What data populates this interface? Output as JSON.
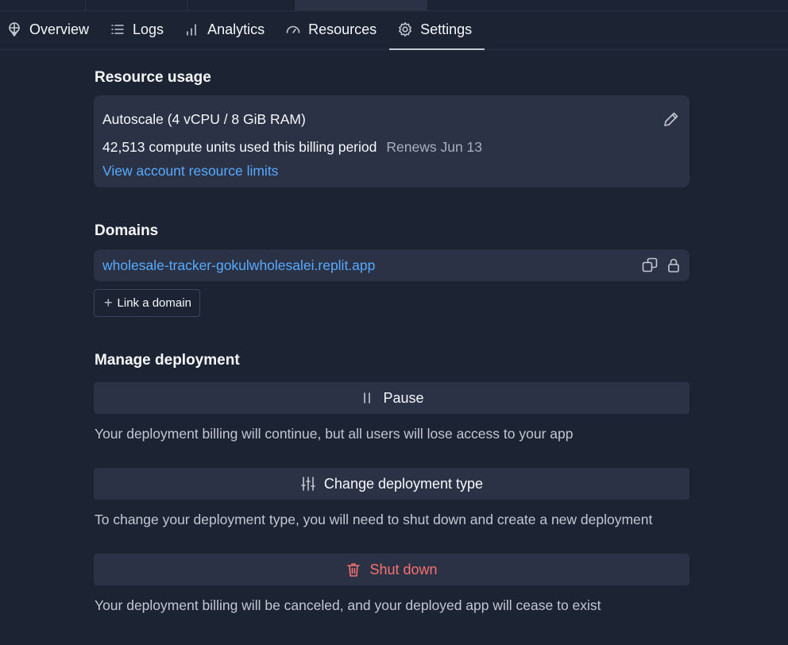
{
  "nav": {
    "tabs": [
      {
        "label": "Overview",
        "icon": "deploy-icon"
      },
      {
        "label": "Logs",
        "icon": "list-icon"
      },
      {
        "label": "Analytics",
        "icon": "bar-chart-icon"
      },
      {
        "label": "Resources",
        "icon": "gauge-icon"
      },
      {
        "label": "Settings",
        "icon": "gear-icon",
        "active": true
      }
    ]
  },
  "resource_usage": {
    "title": "Resource usage",
    "plan": "Autoscale (4 vCPU / 8 GiB RAM)",
    "usage": "42,513 compute units used this billing period",
    "renews": "Renews Jun 13",
    "limits_link": "View account resource limits"
  },
  "domains": {
    "title": "Domains",
    "url": "wholesale-tracker-gokulwholesalei.replit.app",
    "link_button": "Link a domain"
  },
  "manage": {
    "title": "Manage deployment",
    "pause": {
      "label": "Pause",
      "description": "Your deployment billing will continue, but all users will lose access to your app"
    },
    "change_type": {
      "label": "Change deployment type",
      "description": "To change your deployment type, you will need to shut down and create a new deployment"
    },
    "shutdown": {
      "label": "Shut down",
      "description": "Your deployment billing will be canceled, and your deployed app will cease to exist"
    }
  },
  "colors": {
    "background": "#1c2333",
    "surface": "#2b3245",
    "link": "#57abff",
    "danger": "#f87171"
  }
}
